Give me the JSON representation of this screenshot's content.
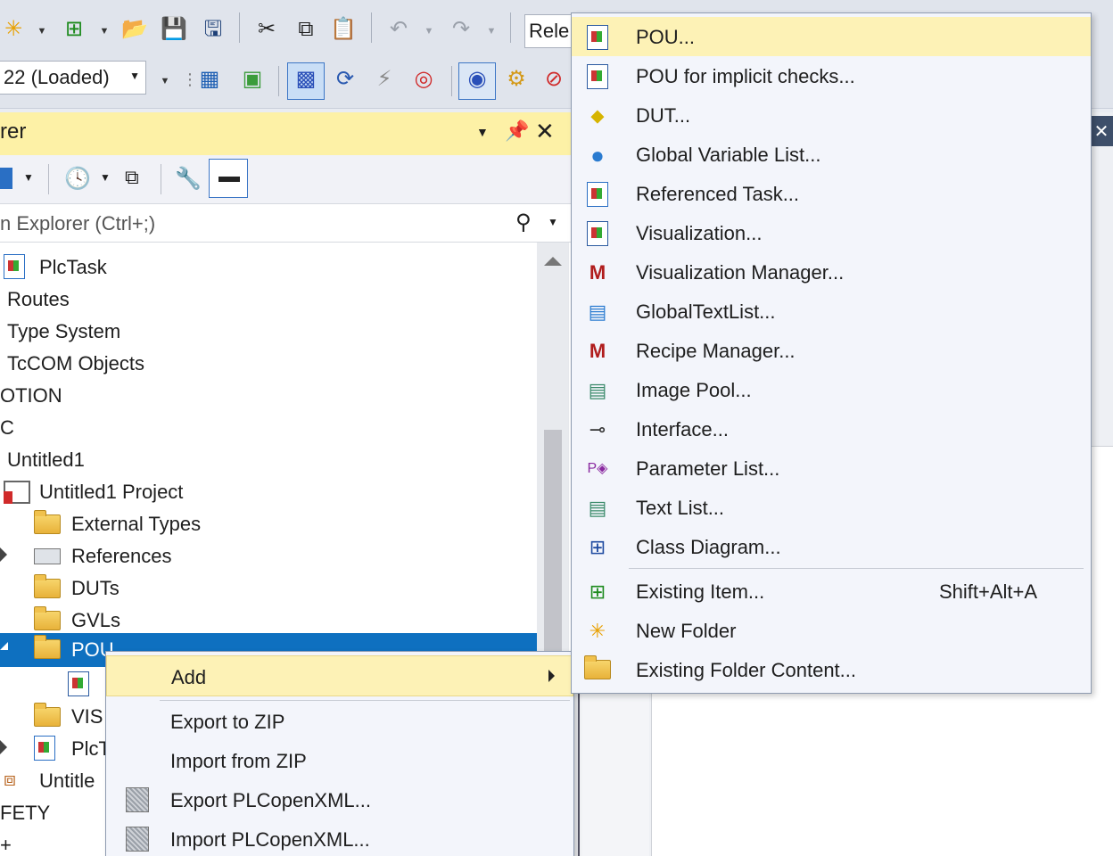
{
  "toolbar": {
    "config_combo": "Rele",
    "target_combo": "22 (Loaded)"
  },
  "panel": {
    "title": "rer",
    "search_placeholder": "n Explorer (Ctrl+;)"
  },
  "tree": [
    {
      "label": "PlcTask",
      "indent": 44
    },
    {
      "label": "Routes",
      "indent": 8
    },
    {
      "label": "Type System",
      "indent": 8
    },
    {
      "label": "TcCOM Objects",
      "indent": 8
    },
    {
      "label": "OTION",
      "indent": 0
    },
    {
      "label": "C",
      "indent": 0
    },
    {
      "label": "Untitled1",
      "indent": 8
    },
    {
      "label": "Untitled1 Project",
      "indent": 44
    },
    {
      "label": "External Types",
      "indent": 80
    },
    {
      "label": "References",
      "indent": 80
    },
    {
      "label": "DUTs",
      "indent": 80
    },
    {
      "label": "GVLs",
      "indent": 80
    },
    {
      "label": "POU",
      "indent": 80
    },
    {
      "label": "",
      "indent": 116
    },
    {
      "label": "VIS",
      "indent": 80
    },
    {
      "label": "PlcT",
      "indent": 80
    },
    {
      "label": "Untitle",
      "indent": 44
    },
    {
      "label": "FETY",
      "indent": 0
    },
    {
      "label": "+",
      "indent": 0
    }
  ],
  "context_menu": {
    "add": "Add",
    "export_zip": "Export to ZIP",
    "import_zip": "Import from ZIP",
    "export_xml": "Export PLCopenXML...",
    "import_xml": "Import PLCopenXML..."
  },
  "submenu": {
    "items": [
      {
        "label": "POU...",
        "icon": "pou-icon"
      },
      {
        "label": "POU for implicit checks...",
        "icon": "pou-implicit-icon"
      },
      {
        "label": "DUT...",
        "icon": "dut-icon"
      },
      {
        "label": "Global Variable List...",
        "icon": "globe-icon"
      },
      {
        "label": "Referenced Task...",
        "icon": "task-icon"
      },
      {
        "label": "Visualization...",
        "icon": "visualization-icon"
      },
      {
        "label": "Visualization Manager...",
        "icon": "visualization-manager-icon"
      },
      {
        "label": "GlobalTextList...",
        "icon": "global-text-list-icon"
      },
      {
        "label": "Recipe Manager...",
        "icon": "recipe-manager-icon"
      },
      {
        "label": "Image Pool...",
        "icon": "image-pool-icon"
      },
      {
        "label": "Interface...",
        "icon": "interface-icon"
      },
      {
        "label": "Parameter List...",
        "icon": "parameter-list-icon"
      },
      {
        "label": "Text List...",
        "icon": "text-list-icon"
      },
      {
        "label": "Class Diagram...",
        "icon": "class-diagram-icon"
      }
    ],
    "existing_item": "Existing Item...",
    "existing_item_shortcut": "Shift+Alt+A",
    "new_folder": "New Folder",
    "existing_folder": "Existing Folder Content..."
  },
  "colors": {
    "highlight": "#fdf2b6",
    "selection": "#0e70c0",
    "panel_title": "#fdf1a6"
  }
}
